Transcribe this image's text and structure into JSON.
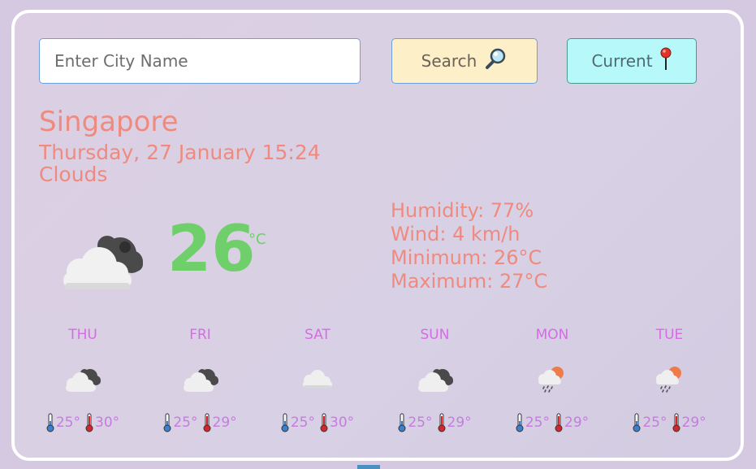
{
  "search": {
    "placeholder": "Enter City Name",
    "value": ""
  },
  "buttons": {
    "search_label": "Search",
    "current_label": "Current"
  },
  "location": {
    "city": "Singapore",
    "datetime": "Thursday, 27 January 15:24",
    "condition": "Clouds"
  },
  "current": {
    "temp": "26",
    "unit": "°C",
    "icon": "cloudy-icon",
    "humidity": "Humidity: 77%",
    "wind": "Wind: 4 km/h",
    "minimum": "Minimum: 26°C",
    "maximum": "Maximum: 27°C"
  },
  "forecast": [
    {
      "day": "THU",
      "icon": "cloudy-icon",
      "min": "25°",
      "max": "30°"
    },
    {
      "day": "FRI",
      "icon": "cloudy-icon",
      "min": "25°",
      "max": "29°"
    },
    {
      "day": "SAT",
      "icon": "cloud-icon",
      "min": "25°",
      "max": "30°"
    },
    {
      "day": "SUN",
      "icon": "cloudy-icon",
      "min": "25°",
      "max": "29°"
    },
    {
      "day": "MON",
      "icon": "rain-sun-icon",
      "min": "25°",
      "max": "29°"
    },
    {
      "day": "TUE",
      "icon": "rain-sun-icon",
      "min": "25°",
      "max": "29°"
    }
  ],
  "colors": {
    "accent_text": "#ef8a7f",
    "temperature": "#6fcf6a",
    "forecast_day": "#d86ae8",
    "search_button_bg": "#fdefc8",
    "current_button_bg": "#b7f9fb"
  }
}
